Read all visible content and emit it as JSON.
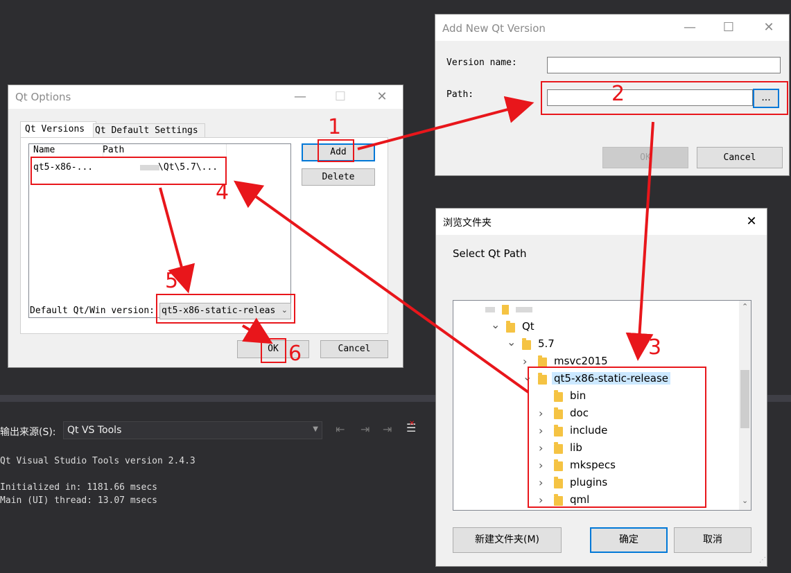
{
  "vs_top_bar": {
    "bg": "#2d2d30"
  },
  "output_panel": {
    "source_label": "输出来源(S):",
    "source_value": "Qt VS Tools",
    "lines": [
      "Qt Visual Studio Tools version 2.4.3",
      "",
      "Initialized in: 1181.66 msecs",
      "Main (UI) thread: 13.07 msecs"
    ]
  },
  "qt_options": {
    "title": "Qt Options",
    "tabs": [
      "Qt Versions",
      "Qt Default Settings"
    ],
    "columns": [
      "Name",
      "Path"
    ],
    "row": {
      "name": "qt5-x86-...",
      "path": "\\Qt\\5.7\\..."
    },
    "add_label": "Add",
    "delete_label": "Delete",
    "default_label": "Default Qt/Win version:",
    "default_value": "qt5-x86-static-releas",
    "ok_label": "OK",
    "cancel_label": "Cancel"
  },
  "add_version": {
    "title": "Add New Qt Version",
    "version_name_label": "Version name:",
    "path_label": "Path:",
    "browse_label": "...",
    "ok_label": "OK",
    "cancel_label": "Cancel"
  },
  "browse_folder": {
    "title": "浏览文件夹",
    "prompt": "Select Qt Path",
    "tree": [
      {
        "label": "Qt",
        "level": 1,
        "expanded": true
      },
      {
        "label": "5.7",
        "level": 2,
        "expanded": true
      },
      {
        "label": "msvc2015",
        "level": 3,
        "expanded": false
      },
      {
        "label": "qt5-x86-static-release",
        "level": 3,
        "expanded": true,
        "selected": true
      },
      {
        "label": "bin",
        "level": 4,
        "expanded": null
      },
      {
        "label": "doc",
        "level": 4,
        "expanded": false
      },
      {
        "label": "include",
        "level": 4,
        "expanded": false
      },
      {
        "label": "lib",
        "level": 4,
        "expanded": false
      },
      {
        "label": "mkspecs",
        "level": 4,
        "expanded": false
      },
      {
        "label": "plugins",
        "level": 4,
        "expanded": false
      },
      {
        "label": "qml",
        "level": 4,
        "expanded": false
      }
    ],
    "new_folder_label": "新建文件夹(M)",
    "ok_label": "确定",
    "cancel_label": "取消"
  },
  "annotations": [
    "1",
    "2",
    "3",
    "4",
    "5",
    "6"
  ],
  "colors": {
    "annotation_red": "#e8161b",
    "accent_blue": "#0078d7",
    "selection": "#cce8ff"
  }
}
